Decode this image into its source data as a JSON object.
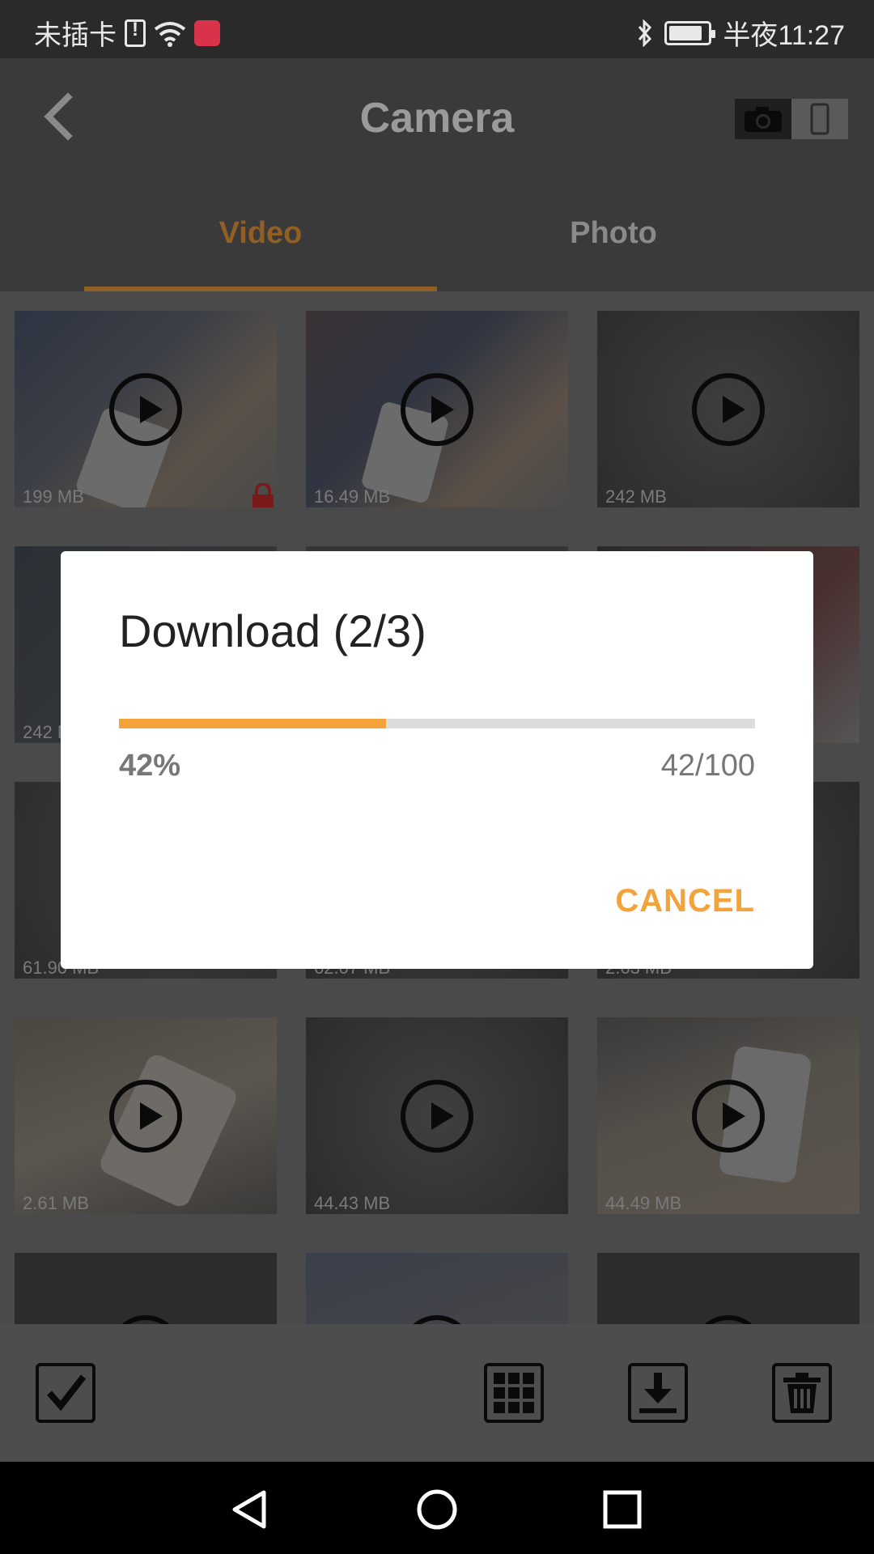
{
  "status_bar": {
    "carrier": "未插卡",
    "time": "半夜11:27"
  },
  "header": {
    "title": "Camera"
  },
  "tabs": [
    {
      "label": "Video",
      "active": true
    },
    {
      "label": "Photo",
      "active": false
    }
  ],
  "thumbnails": [
    {
      "size": "199 MB",
      "locked": true,
      "scene": "desk-phone"
    },
    {
      "size": "16.49 MB",
      "scene": "desk-phone"
    },
    {
      "size": "242 MB",
      "scene": "dark"
    },
    {
      "size": "242 MB",
      "scene": "dark-red"
    },
    {
      "size": "",
      "scene": "dark"
    },
    {
      "size": "",
      "scene": "dark-red"
    },
    {
      "size": "61.90 MB",
      "scene": "dark"
    },
    {
      "size": "62.07 MB",
      "scene": "dark"
    },
    {
      "size": "2.63 MB",
      "scene": "dark"
    },
    {
      "size": "2.61 MB",
      "scene": "phone-hand"
    },
    {
      "size": "44.43 MB",
      "scene": "dark"
    },
    {
      "size": "44.49 MB",
      "scene": "phone-desk"
    },
    {
      "size": "",
      "scene": "dark"
    },
    {
      "size": "",
      "scene": "phone-hand"
    },
    {
      "size": "",
      "scene": "dark"
    }
  ],
  "dialog": {
    "title": "Download (2/3)",
    "progress_fraction": 0.42,
    "percent_label": "42%",
    "count_label": "42/100",
    "cancel_label": "CANCEL"
  },
  "colors": {
    "accent": "#f3a33a",
    "accent_dimmed": "#8f5f23",
    "dialog_bg": "#ffffff"
  },
  "icons": {
    "toolbar": [
      "checkbox-icon",
      "grid-view-icon",
      "download-icon",
      "trash-icon"
    ],
    "navbar": [
      "back-triangle-icon",
      "home-circle-icon",
      "recents-square-icon"
    ]
  }
}
